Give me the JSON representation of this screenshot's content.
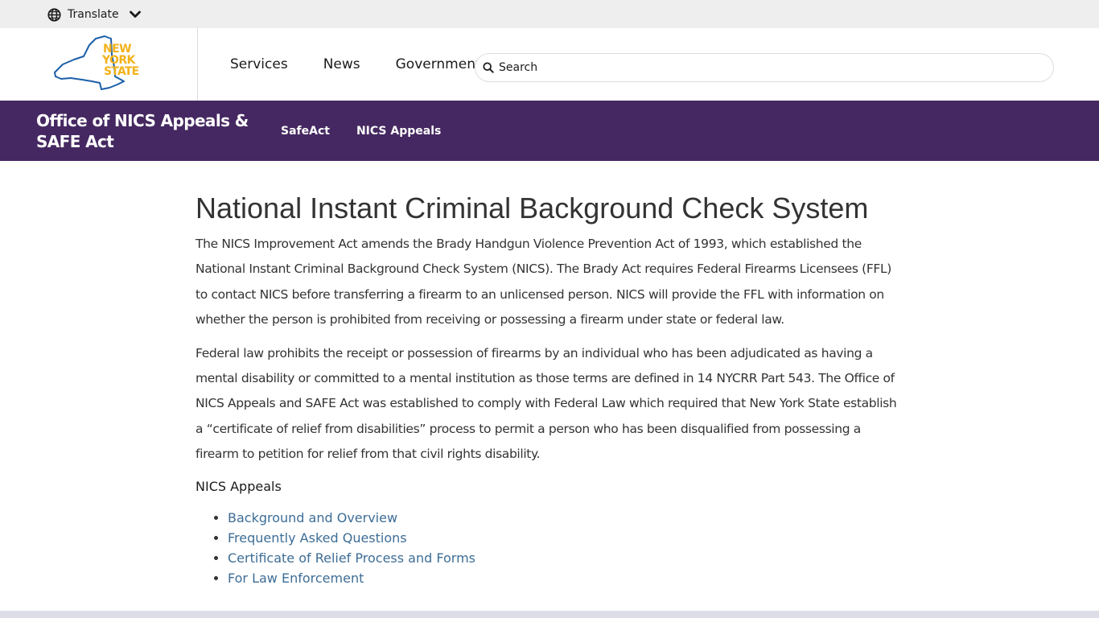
{
  "translate": {
    "label": "Translate"
  },
  "logo": {
    "line1": "NEW",
    "line2": "YORK",
    "line3": "STATE"
  },
  "main_nav": [
    {
      "label": "Services"
    },
    {
      "label": "News"
    },
    {
      "label": "Government"
    }
  ],
  "search": {
    "placeholder": "Search"
  },
  "agency": {
    "title": "Office of NICS Appeals & SAFE Act",
    "nav": [
      {
        "label": "SafeAct"
      },
      {
        "label": "NICS Appeals"
      }
    ]
  },
  "content": {
    "heading": "National Instant Criminal Background Check System",
    "paragraphs": [
      "The NICS Improvement Act amends the Brady Handgun Violence Prevention Act of 1993, which established the National Instant Criminal Background Check System (NICS). The Brady Act requires Federal Firearms Licensees (FFL) to contact NICS before transferring a firearm to an unlicensed person. NICS will provide the FFL with information on whether the person is prohibited from receiving or possessing a firearm under state or federal law.",
      "Federal law prohibits the receipt or possession of firearms by an individual who has been adjudicated as having a mental disability or committed to a mental institution as those terms are defined in 14 NYCRR Part 543. The Office of NICS Appeals and SAFE Act was established to comply with Federal Law which required that New York State establish a “certificate of relief from disabilities” process to permit a person who has been disqualified from possessing a firearm to petition for relief from that civil rights disability."
    ],
    "subheading": "NICS Appeals",
    "links": [
      {
        "label": "Background and Overview"
      },
      {
        "label": "Frequently Asked Questions"
      },
      {
        "label": "Certificate of Relief Process and Forms"
      },
      {
        "label": "For Law Enforcement"
      }
    ]
  },
  "colors": {
    "agency_bar": "#452861",
    "logo_blue": "#1c5fa8",
    "logo_gold": "#f2b21a",
    "link": "#3d6d96"
  }
}
